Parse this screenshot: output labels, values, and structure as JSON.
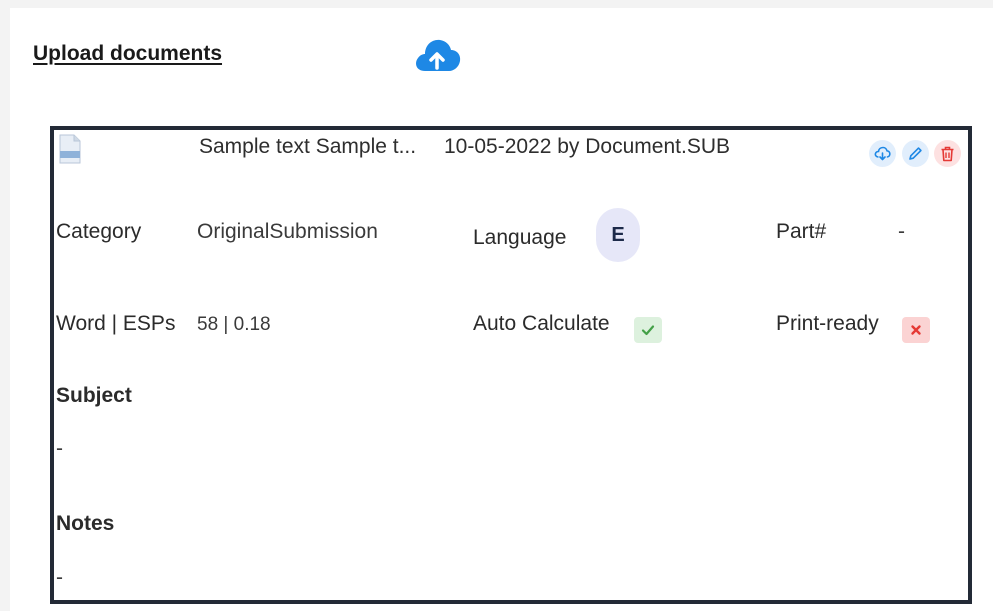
{
  "header": {
    "title": "Upload documents",
    "upload_icon": "cloud-upload-icon"
  },
  "document": {
    "file_icon": "doc-file-icon",
    "name": "Sample text Sample t...",
    "meta": "10-05-2022 by Document.SUB",
    "actions": {
      "download_icon": "cloud-download-icon",
      "edit_icon": "pencil-icon",
      "delete_icon": "trash-icon"
    },
    "category_label": "Category",
    "category_value": "OriginalSubmission",
    "language_label": "Language",
    "language_value": "E",
    "part_label": "Part#",
    "part_value": "-",
    "word_esps_label": "Word | ESPs",
    "word_esps_value": "58 | 0.18",
    "auto_calculate_label": "Auto Calculate",
    "auto_calculate_enabled": true,
    "print_ready_label": "Print-ready",
    "print_ready_enabled": false,
    "subject_label": "Subject",
    "subject_value": "-",
    "notes_label": "Notes",
    "notes_value": "-"
  },
  "colors": {
    "accent_blue": "#1e88e5",
    "danger_red": "#e53935",
    "success_green": "#43a047",
    "card_border": "#232a36"
  }
}
